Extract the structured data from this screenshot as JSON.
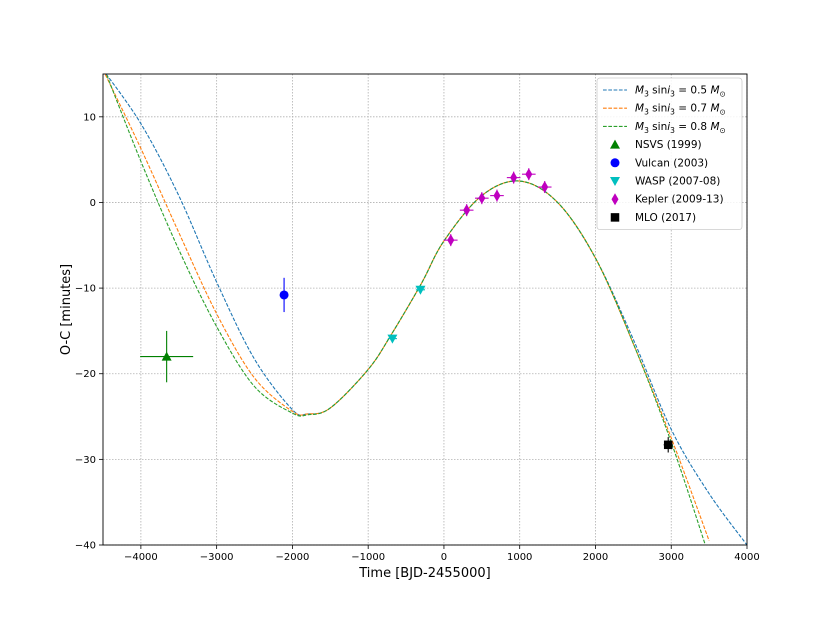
{
  "chart_data": {
    "type": "scatter",
    "xlabel": "Time [BJD-2455000]",
    "ylabel": "O-C [minutes]",
    "xlim": [
      -4500,
      4000
    ],
    "ylim": [
      -40,
      15
    ],
    "xticks": [
      -4000,
      -3000,
      -2000,
      -1000,
      0,
      1000,
      2000,
      3000,
      4000
    ],
    "yticks": [
      10,
      0,
      -10,
      -20,
      -30,
      -40
    ],
    "grid": true,
    "legend_position": "upper-right",
    "model_curves": [
      {
        "label_sub": "3",
        "label_value": " = 0.5 ",
        "color": "#1f77b4",
        "style": "dashed",
        "x": [
          -4500,
          -4000,
          -3500,
          -3000,
          -2500,
          -2000,
          -1800,
          -1500,
          -1000,
          -700,
          -300,
          0,
          500,
          1000,
          1500,
          2000,
          2500,
          3000,
          3500,
          4000
        ],
        "y": [
          15.5,
          9.2,
          0.8,
          -9.3,
          -18.3,
          -24.2,
          -24.7,
          -24,
          -19.5,
          -15.5,
          -9.5,
          -4.5,
          0.8,
          2.5,
          0,
          -6.5,
          -16,
          -26.5,
          -34,
          -40
        ]
      },
      {
        "label_sub": "3",
        "label_value": " = 0.7 ",
        "color": "#ff7f0e",
        "style": "dashed",
        "x": [
          -4500,
          -4000,
          -3500,
          -3000,
          -2500,
          -2000,
          -1800,
          -1500,
          -1000,
          -700,
          -300,
          0,
          500,
          1000,
          1500,
          2000,
          2500,
          3000,
          3500
        ],
        "y": [
          15.5,
          6.3,
          -3.5,
          -13,
          -20.5,
          -24.4,
          -24.7,
          -24,
          -19.5,
          -15.5,
          -9.5,
          -4.5,
          0.8,
          2.5,
          0,
          -6.5,
          -16.5,
          -27.5,
          -39.5
        ]
      },
      {
        "label_sub": "3",
        "label_value": " = 0.8 ",
        "color": "#2ca02c",
        "style": "dashed",
        "x": [
          -4500,
          -4000,
          -3500,
          -3000,
          -2500,
          -2000,
          -1800,
          -1500,
          -1000,
          -700,
          -300,
          0,
          500,
          1000,
          1500,
          2000,
          2500,
          3000,
          3450
        ],
        "y": [
          16,
          4.8,
          -5.5,
          -14.5,
          -21.5,
          -24.6,
          -24.8,
          -24,
          -19.5,
          -15.5,
          -9.5,
          -4.5,
          0.8,
          2.5,
          0,
          -6.5,
          -16.5,
          -28,
          -40
        ]
      }
    ],
    "series": [
      {
        "name": "NSVS (1999)",
        "color": "#008000",
        "marker": "triangle-up",
        "points": [
          {
            "x": -3660,
            "y": -18,
            "xerr": 350,
            "yerr": 3
          }
        ]
      },
      {
        "name": "Vulcan (2003)",
        "color": "#0000ff",
        "marker": "circle",
        "points": [
          {
            "x": -2110,
            "y": -10.8,
            "xerr": 0,
            "yerr": 2
          }
        ]
      },
      {
        "name": "WASP (2007-08)",
        "color": "#00bfbf",
        "marker": "triangle-down",
        "points": [
          {
            "x": -680,
            "y": -15.9,
            "xerr": 60,
            "yerr": 0.4
          },
          {
            "x": -310,
            "y": -10.2,
            "xerr": 60,
            "yerr": 0.4
          }
        ]
      },
      {
        "name": "Kepler (2009-13)",
        "color": "#bf00bf",
        "marker": "thin-diamond",
        "points": [
          {
            "x": 90,
            "y": -4.4,
            "xerr": 90,
            "yerr": 0.7
          },
          {
            "x": 300,
            "y": -0.9,
            "xerr": 90,
            "yerr": 0.7
          },
          {
            "x": 500,
            "y": 0.5,
            "xerr": 90,
            "yerr": 0.7
          },
          {
            "x": 700,
            "y": 0.8,
            "xerr": 90,
            "yerr": 0.7
          },
          {
            "x": 920,
            "y": 2.9,
            "xerr": 90,
            "yerr": 0.7
          },
          {
            "x": 1120,
            "y": 3.3,
            "xerr": 90,
            "yerr": 0.7
          },
          {
            "x": 1330,
            "y": 1.8,
            "xerr": 90,
            "yerr": 0.7
          }
        ]
      },
      {
        "name": "MLO (2017)",
        "color": "#000000",
        "marker": "square",
        "points": [
          {
            "x": 2960,
            "y": -28.3,
            "xerr": 60,
            "yerr": 0.9
          }
        ]
      }
    ]
  }
}
